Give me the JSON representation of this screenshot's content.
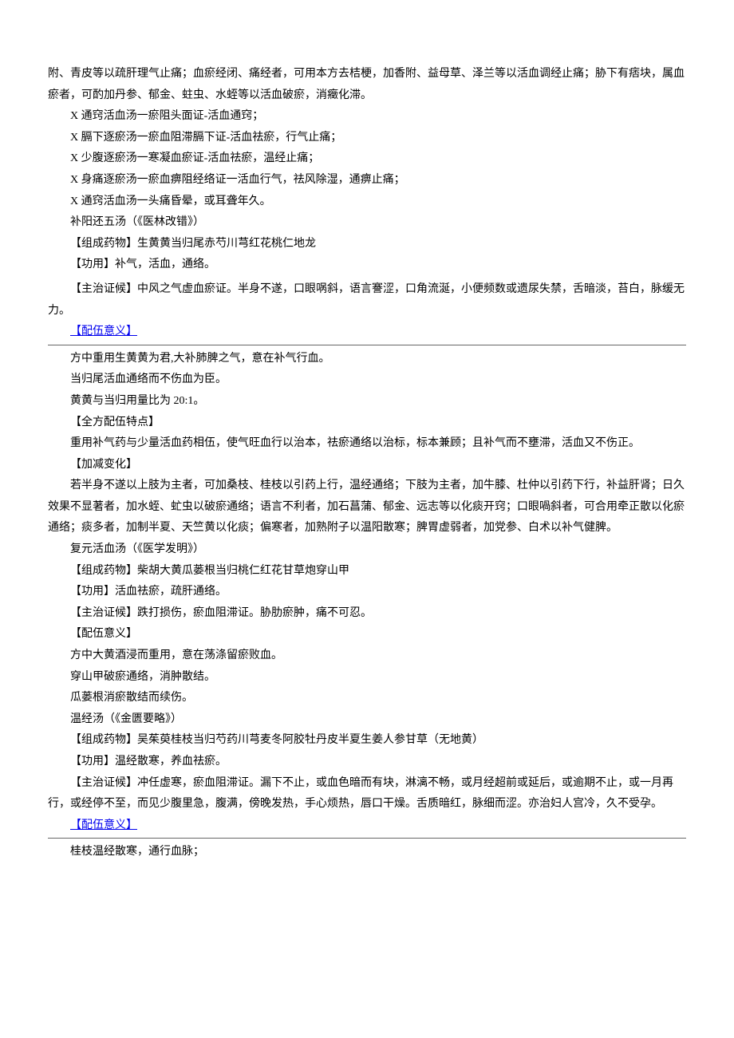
{
  "p1": "附、青皮等以疏肝理气止痛；血瘀经闭、痛经者，可用本方去桔梗，加香附、益母草、泽兰等以活血调经止痛；胁下有痞块，属血瘀者，可酌加丹参、郁金、蛀虫、水蛭等以活血破瘀，消癥化滞。",
  "x1": "X 通窍活血汤一瘀阻头面证-活血通窍；",
  "x2": "X 膈下逐瘀汤一瘀血阻滞膈下证-活血祛瘀，行气止痛；",
  "x3": "X 少腹逐瘀汤一寒凝血瘀证-活血祛瘀，温经止痛；",
  "x4": "X 身痛逐瘀汤一瘀血痹阻经络证一活血行气，祛风除湿，通痹止痛；",
  "x5": "X 通窍活血汤一头痛昏晕，或耳聋年久。",
  "by_title": "补阳还五汤（《医林改错》）",
  "by_comp": "【组成药物】生黄黄当归尾赤芍川芎红花桃仁地龙",
  "by_func": "【功用】补气，活血，通络。",
  "by_symp": "【主治证候】中风之气虚血瘀证。半身不遂，口眼㖞斜，语言謇涩，口角流涎，小便频数或遗尿失禁，舌暗淡，苔白，脉缓无力。",
  "pwyi_label": "【配伍意义】",
  "by_pw1": "方中重用生黄黄为君,大补肺脾之气，意在补气行血。",
  "by_pw2": "当归尾活血通络而不伤血为臣。",
  "by_pw3": "黄黄与当归用量比为 20:1。",
  "qf_label": "【全方配伍特点】",
  "qf_body": "重用补气药与少量活血药相伍，使气旺血行以治本，祛瘀通络以治标，标本兼顾；且补气而不壅滞，活血又不伤正。",
  "jj_label": "【加减变化】",
  "jj_body": "若半身不遂以上肢为主者，可加桑枝、桂枝以引药上行，温经通络；下肢为主者，加牛膝、杜仲以引药下行，补益肝肾；日久效果不显著者，加水蛭、虻虫以破瘀通络；语言不利者，加石菖蒲、郁金、远志等以化痰开窍；口眼喎斜者，可合用牵正散以化瘀通络；痰多者，加制半夏、天竺黄以化痰；偏寒者，加熟附子以温阳散寒；脾胃虚弱者，加党参、白术以补气健脾。",
  "fy_title": "复元活血汤（《医学发明》）",
  "fy_comp": "【组成药物】柴胡大黄瓜蒌根当归桃仁红花甘草炮穿山甲",
  "fy_func": "【功用】活血祛瘀，疏肝通络。",
  "fy_symp": "【主治证候】跌打损伤，瘀血阻滞证。胁肋瘀肿，痛不可忍。",
  "fy_pw_label": "【配伍意义】",
  "fy_pw1": "方中大黄酒浸而重用，意在荡涤留瘀败血。",
  "fy_pw2": "穿山甲破瘀通络，消肿散结。",
  "fy_pw3": "瓜蒌根消瘀散结而续伤。",
  "wj_title": "温经汤（《金匮要略》）",
  "wj_comp": "【组成药物】吴茱萸桂枝当归芍药川芎麦冬阿胶牡丹皮半夏生姜人参甘草（无地黄）",
  "wj_func": "【功用】温经散寒，养血祛瘀。",
  "wj_symp": "【主治证候】冲任虚寒，瘀血阻滞证。漏下不止，或血色暗而有块，淋漓不畅，或月经超前或延后，或逾期不止，或一月再行，或经停不至，而见少腹里急，腹满，傍晚发热，手心烦热，唇口干燥。舌质暗红，脉细而涩。亦治妇人宫冷，久不受孕。",
  "wj_pw1": "桂枝温经散寒，通行血脉；"
}
